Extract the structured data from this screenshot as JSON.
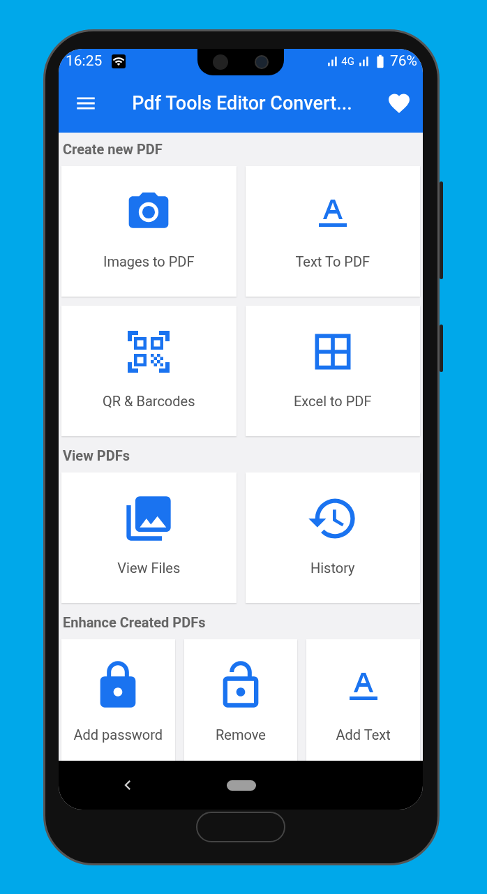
{
  "status_bar": {
    "time": "16:25",
    "network": "4G",
    "battery": "76%"
  },
  "app_bar": {
    "title": "Pdf Tools Editor Convert..."
  },
  "sections": [
    {
      "title": "Create new PDF",
      "items": [
        {
          "label": "Images to PDF",
          "kind": "camera"
        },
        {
          "label": "Text To PDF",
          "kind": "text"
        },
        {
          "label": "QR & Barcodes",
          "kind": "qr"
        },
        {
          "label": "Excel to PDF",
          "kind": "grid"
        }
      ]
    },
    {
      "title": "View PDFs",
      "items": [
        {
          "label": "View Files",
          "kind": "images"
        },
        {
          "label": "History",
          "kind": "history"
        }
      ]
    },
    {
      "title": "Enhance Created PDFs",
      "items": [
        {
          "label": "Add password",
          "kind": "lock"
        },
        {
          "label": "Remove",
          "kind": "unlock"
        },
        {
          "label": "Add Text",
          "kind": "text"
        }
      ]
    }
  ]
}
